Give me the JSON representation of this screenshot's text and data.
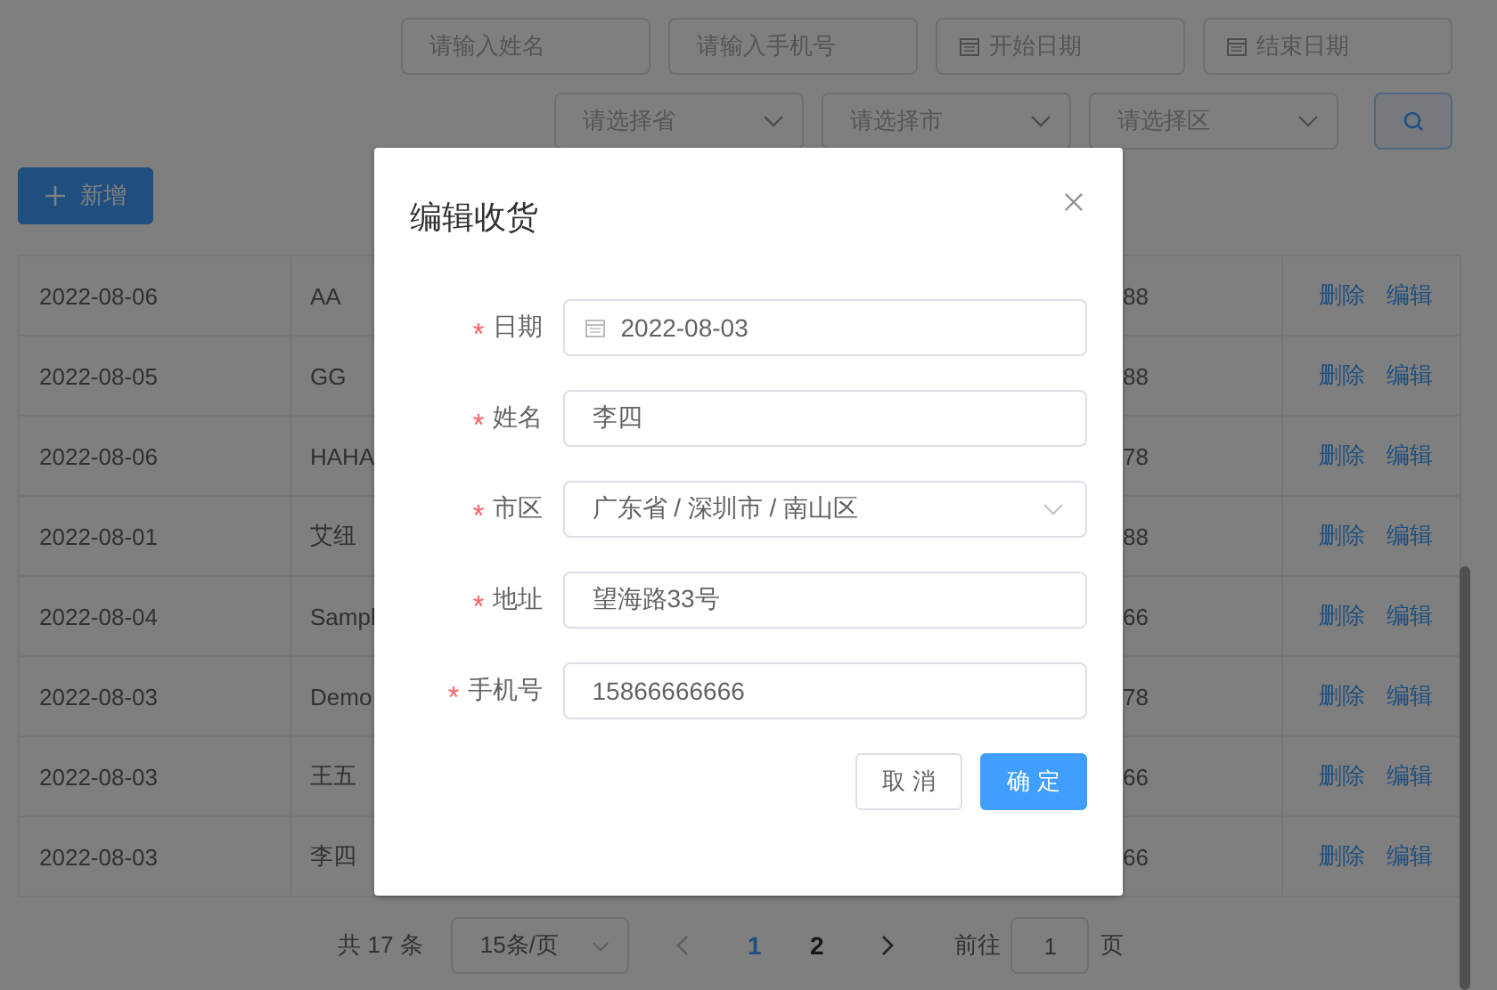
{
  "filters": [
    {
      "kind": "input",
      "placeholder": "请输入姓名"
    },
    {
      "kind": "input",
      "placeholder": "请输入手机号"
    },
    {
      "kind": "date",
      "placeholder": "开始日期"
    },
    {
      "kind": "date",
      "placeholder": "结束日期"
    }
  ],
  "selects": [
    {
      "kind": "select",
      "placeholder": "请选择省"
    },
    {
      "kind": "select",
      "placeholder": "请选择市"
    },
    {
      "kind": "select",
      "placeholder": "请选择区"
    }
  ],
  "add_button": {
    "label": "新增"
  },
  "table": {
    "rows": [
      {
        "date": "2022-08-06",
        "name": "AA",
        "column_3": "88",
        "actions": [
          "删除",
          "编辑"
        ]
      },
      {
        "date": "2022-08-05",
        "name": "GG",
        "column_3": "88",
        "actions": [
          "删除",
          "编辑"
        ]
      },
      {
        "date": "2022-08-06",
        "name": "HAHA",
        "column_3": "78",
        "actions": [
          "删除",
          "编辑"
        ]
      },
      {
        "date": "2022-08-01",
        "name": "艾纽",
        "column_3": "88",
        "actions": [
          "删除",
          "编辑"
        ]
      },
      {
        "date": "2022-08-04",
        "name": "Sampl",
        "column_3": "66",
        "actions": [
          "删除",
          "编辑"
        ]
      },
      {
        "date": "2022-08-03",
        "name": "Demo",
        "column_3": "78",
        "actions": [
          "删除",
          "编辑"
        ]
      },
      {
        "date": "2022-08-03",
        "name": "王五",
        "column_3": "66",
        "actions": [
          "删除",
          "编辑"
        ]
      },
      {
        "date": "2022-08-03",
        "name": "李四",
        "column_3": "66",
        "actions": [
          "删除",
          "编辑"
        ]
      }
    ]
  },
  "pagination": {
    "total": "共 17 条",
    "page_size": "15条/页",
    "pages": [
      {
        "label": "1",
        "selected": true
      },
      {
        "label": "2",
        "selected": false
      }
    ],
    "goto_label": "前往",
    "goto_value": "1",
    "goto_suffix": "页"
  },
  "dialog": {
    "title": "编辑收货",
    "fields": [
      {
        "label": "日期",
        "required": true,
        "kind": "date",
        "value": "2022-08-03"
      },
      {
        "label": "姓名",
        "required": true,
        "kind": "text",
        "value": "李四"
      },
      {
        "label": "市区",
        "required": true,
        "kind": "select",
        "value": "广东省 / 深圳市 / 南山区"
      },
      {
        "label": "地址",
        "required": true,
        "kind": "text",
        "value": "望海路33号"
      },
      {
        "label": "手机号",
        "required": true,
        "kind": "text",
        "value": "15866666666"
      }
    ],
    "buttons": [
      {
        "label": "取 消",
        "kind": "default"
      },
      {
        "label": "确 定",
        "kind": "primary"
      }
    ]
  }
}
